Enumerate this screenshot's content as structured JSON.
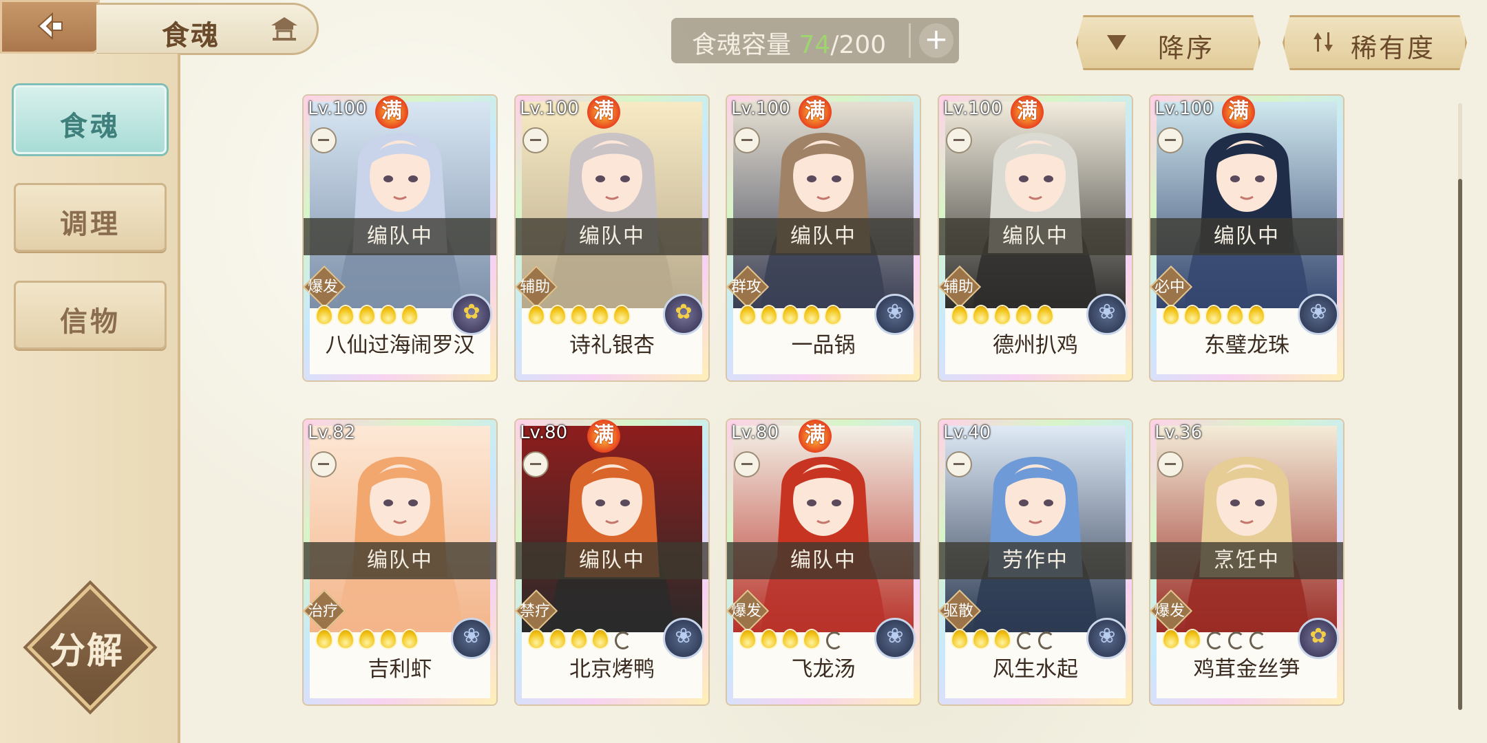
{
  "header": {
    "title": "食魂",
    "capacity_label": "食魂容量",
    "capacity_current": "74",
    "capacity_total": "/200",
    "sort_order": "降序",
    "sort_by": "稀有度"
  },
  "sidebar": {
    "tabs": [
      {
        "label": "食魂",
        "active": true
      },
      {
        "label": "调理",
        "active": false
      },
      {
        "label": "信物",
        "active": false
      }
    ],
    "decompose": "分解"
  },
  "cards": [
    {
      "level": "Lv.100",
      "full": "满",
      "status": "编队中",
      "role": "爆发",
      "stars": 5,
      "max_stars": 5,
      "element": "gold",
      "name": "八仙过海闹罗汉",
      "bg": [
        "#d8e6f3",
        "#7c8fa8"
      ],
      "hair": "#c9d4ea"
    },
    {
      "level": "Lv.100",
      "full": "满",
      "status": "编队中",
      "role": "辅助",
      "stars": 5,
      "max_stars": 5,
      "element": "gold",
      "name": "诗礼银杏",
      "bg": [
        "#f7eac4",
        "#b7a98c"
      ],
      "hair": "#c9c3c6"
    },
    {
      "level": "Lv.100",
      "full": "满",
      "status": "编队中",
      "role": "群攻",
      "stars": 5,
      "max_stars": 5,
      "element": "blue",
      "name": "一品锅",
      "bg": [
        "#e6e0d2",
        "#3a3f55"
      ],
      "hair": "#a08266"
    },
    {
      "level": "Lv.100",
      "full": "满",
      "status": "编队中",
      "role": "辅助",
      "stars": 5,
      "max_stars": 5,
      "element": "blue",
      "name": "德州扒鸡",
      "bg": [
        "#f1ecdd",
        "#2e2d2c"
      ],
      "hair": "#dadad3"
    },
    {
      "level": "Lv.100",
      "full": "满",
      "status": "编队中",
      "role": "必中",
      "stars": 5,
      "max_stars": 5,
      "element": "blue",
      "name": "东璧龙珠",
      "bg": [
        "#cfe7ee",
        "#35466e"
      ],
      "hair": "#202d48"
    },
    {
      "level": "Lv.82",
      "full": "",
      "status": "编队中",
      "role": "治疗",
      "stars": 5,
      "max_stars": 5,
      "element": "blue",
      "name": "吉利虾",
      "bg": [
        "#fde8d6",
        "#f3b58a"
      ],
      "hair": "#f2a76f"
    },
    {
      "level": "Lv.80",
      "full": "满",
      "status": "编队中",
      "role": "禁疗",
      "stars": 4,
      "max_stars": 5,
      "element": "blue",
      "name": "北京烤鸭",
      "bg": [
        "#8e1d1d",
        "#2a2a2a"
      ],
      "hair": "#d9652b"
    },
    {
      "level": "Lv.80",
      "full": "满",
      "status": "编队中",
      "role": "爆发",
      "stars": 4,
      "max_stars": 5,
      "element": "blue",
      "name": "飞龙汤",
      "bg": [
        "#f3f0e6",
        "#b8332a"
      ],
      "hair": "#c83422"
    },
    {
      "level": "Lv.40",
      "full": "",
      "status": "劳作中",
      "role": "驱散",
      "stars": 3,
      "max_stars": 5,
      "element": "blue",
      "name": "风生水起",
      "bg": [
        "#dfeaf6",
        "#2c3a52"
      ],
      "hair": "#6f9ad8"
    },
    {
      "level": "Lv.36",
      "full": "",
      "status": "烹饪中",
      "role": "爆发",
      "stars": 2,
      "max_stars": 5,
      "element": "gold",
      "name": "鸡茸金丝笋",
      "bg": [
        "#f3ecd8",
        "#9a2b25"
      ],
      "hair": "#e6cc95"
    }
  ]
}
